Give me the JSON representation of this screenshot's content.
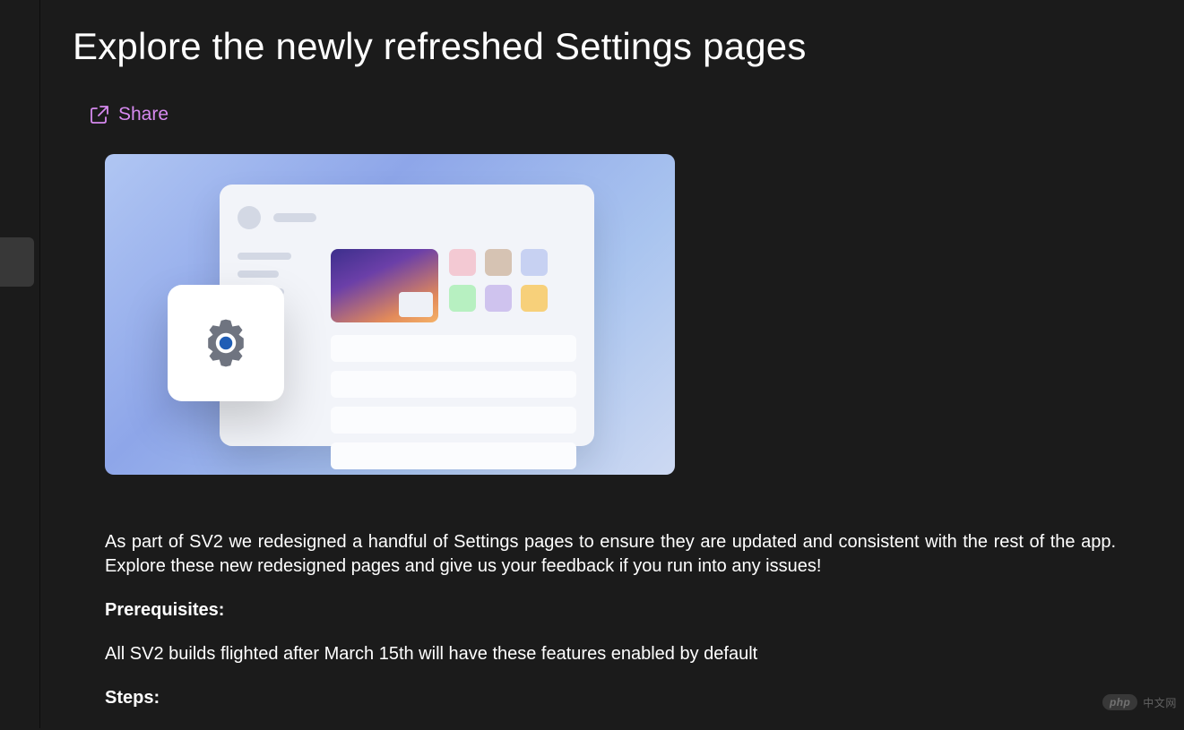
{
  "page": {
    "title": "Explore the newly refreshed Settings pages"
  },
  "actions": {
    "share_label": "Share"
  },
  "body": {
    "intro": "As part of SV2 we redesigned a handful of Settings pages to ensure they are updated and consistent with the rest of the app. Explore these new redesigned pages and give us your feedback if you run into any issues!",
    "prereq_heading": "Prerequisites:",
    "prereq_text": "All SV2 builds flighted after March 15th will have these features enabled by default",
    "steps_heading": "Steps:"
  },
  "watermark": {
    "pill": "php",
    "text": "中文网"
  }
}
